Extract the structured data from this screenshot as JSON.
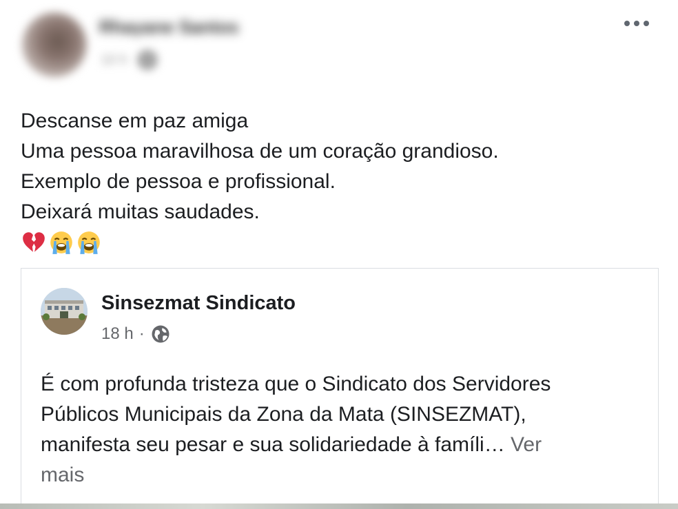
{
  "post": {
    "author_name": "Rhayane Santos",
    "time": "10 h",
    "lines": [
      "Descanse em paz amiga",
      "Uma pessoa maravilhosa de um coração grandioso.",
      "Exemplo de pessoa e profissional.",
      "Deixará muitas saudades."
    ],
    "emojis": [
      "broken-heart",
      "loudly-crying-face",
      "loudly-crying-face"
    ]
  },
  "shared": {
    "page_name": "Sinsezmat Sindicato",
    "time": "18 h",
    "separator": "·",
    "lines": [
      "É com profunda tristeza que o Sindicato dos Servidores",
      "Públicos Municipais da Zona da Mata (SINSEZMAT),",
      "manifesta seu pesar e sua solidariedade à famíli… "
    ],
    "see_more_1": "Ver",
    "see_more_2": "mais"
  },
  "icons": {
    "more": "more-horizontal-icon",
    "globe": "globe-icon"
  },
  "colors": {
    "text": "#1c1e21",
    "secondary": "#65676b",
    "border": "#dadde1"
  }
}
